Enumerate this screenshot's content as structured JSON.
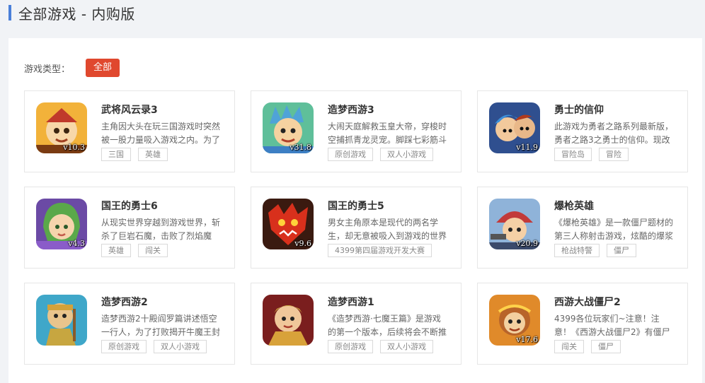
{
  "header": {
    "title": "全部游戏 - 内购版"
  },
  "filter": {
    "label": "游戏类型：",
    "selected": "全部"
  },
  "accent": "#e0482e",
  "games": [
    {
      "title": "武将风云录3",
      "version": "v10.3",
      "description": "主角因大头在玩三国游戏时突然被一股力量吸入游戏之内。为了",
      "tags": [
        "三国",
        "英雄"
      ],
      "icon": "warrior-icon"
    },
    {
      "title": "造梦西游3",
      "version": "v31.8",
      "description": "大闹天庭解救玉皇大帝，穿梭时空捕抓青龙灵宠。脚踩七彩筋斗",
      "tags": [
        "原创游戏",
        "双人小游戏"
      ],
      "icon": "monkey-king-icon"
    },
    {
      "title": "勇士的信仰",
      "version": "v11.9",
      "description": "此游戏为勇者之路系列最新版，勇者之路3之勇士的信仰。现改",
      "tags": [
        "冒险岛",
        "冒险"
      ],
      "icon": "hero-duo-icon"
    },
    {
      "title": "国王的勇士6",
      "version": "v4.3",
      "description": "从现实世界穿越到游戏世界，斩杀了巨岩石魔，击败了烈焰魔",
      "tags": [
        "英雄",
        "闯关"
      ],
      "icon": "elf-girl-icon"
    },
    {
      "title": "国王的勇士5",
      "version": "v9.6",
      "description": "男女主角原本是现代的两名学生，却无意被吸入到游戏的世界",
      "tags": [
        "4399第四届游戏开发大赛"
      ],
      "icon": "red-dragon-icon"
    },
    {
      "title": "爆枪英雄",
      "version": "v20.9",
      "description": "《爆枪英雄》是一款僵尸题材的第三人称射击游戏，炫酷的爆浆",
      "tags": [
        "枪战特警",
        "僵尸"
      ],
      "icon": "gunner-icon"
    },
    {
      "title": "造梦西游2",
      "version": "",
      "description": "造梦西游2十殿阎罗篇讲述悟空一行人，为了打败揭开牛魔王封",
      "tags": [
        "原创游戏",
        "双人小游戏"
      ],
      "icon": "monk-icon"
    },
    {
      "title": "造梦西游1",
      "version": "",
      "description": "《造梦西游·七魔王篇》是游戏的第一个版本，后续将会不断推",
      "tags": [
        "原创游戏",
        "双人小游戏"
      ],
      "icon": "tang-monk-icon"
    },
    {
      "title": "西游大战僵尸2",
      "version": "v17.6",
      "description": "4399各位玩家们~注意！注意！《西游大战僵尸2》有僵尸出",
      "tags": [
        "闯关",
        "僵尸"
      ],
      "icon": "wukong-zombie-icon"
    }
  ]
}
